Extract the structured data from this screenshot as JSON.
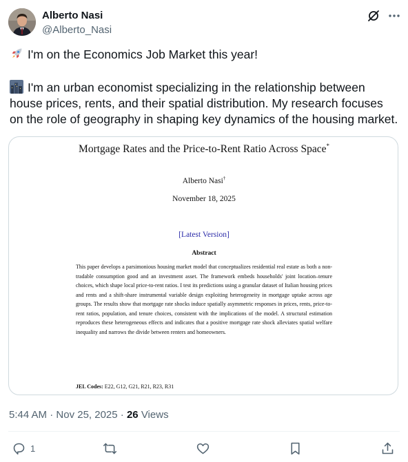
{
  "author": {
    "name": "Alberto Nasi",
    "handle": "@Alberto_Nasi"
  },
  "header_icons": [
    "grok-icon",
    "more-icon"
  ],
  "tweet": {
    "line1": "I'm on the Economics Job Market this year!",
    "line1_emoji": "rocket-icon",
    "paragraph2": "I'm an urban economist specializing in the relationship between house prices, rents, and their spatial distribution. My research focuses on the role of geography in shaping key dynamics of the housing market.",
    "paragraph2_emoji": "cityscape-icon"
  },
  "paper": {
    "title": "Mortgage Rates and the Price-to-Rent Ratio Across Space",
    "title_mark": "*",
    "author": "Alberto Nasi",
    "author_mark": "†",
    "date": "November 18, 2025",
    "link": "[Latest Version]",
    "abstract_heading": "Abstract",
    "abstract": "This paper develops a parsimonious housing market model that conceptualizes residential real estate as both a non-tradable consumption good and an investment asset. The framework embeds households' joint location–tenure choices, which shape local price-to-rent ratios. I test its predictions using a granular dataset of Italian housing prices and rents and a shift-share instrumental variable design exploiting heterogeneity in mortgage uptake across age groups. The results show that mortgage rate shocks induce spatially asymmetric responses in prices, rents, price-to-rent ratios, population, and tenure choices, consistent with the implications of the model. A structural estimation reproduces these heterogeneous effects and indicates that a positive mortgage rate shock alleviates spatial welfare inequality and narrows the divide between renters and homeowners.",
    "jel_label": "JEL Codes:",
    "jel_codes": "E22, G12, G21, R21, R23, R31"
  },
  "meta": {
    "time": "5:44 AM",
    "separator": "·",
    "date": "Nov 25, 2025",
    "views_count": "26",
    "views_label": "Views"
  },
  "actions": {
    "reply_count": "1"
  },
  "colors": {
    "text": "#0f1419",
    "secondary": "#536471",
    "border": "#cfd9de",
    "link": "#2a2aa8"
  }
}
